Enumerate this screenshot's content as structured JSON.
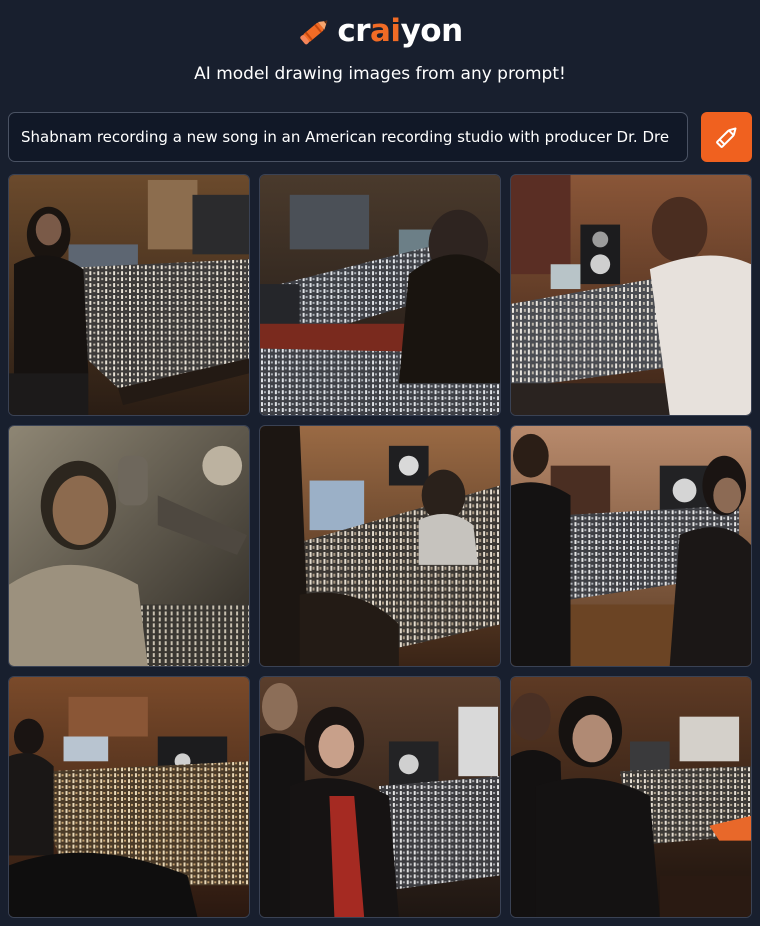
{
  "brand": {
    "name_prefix": "cr",
    "name_accent": "ai",
    "name_suffix": "yon",
    "logo_icon": "crayon-pencil-icon",
    "accent_color": "#f16b25"
  },
  "tagline": "AI model drawing images from any prompt!",
  "prompt": {
    "value": "Shabnam recording a new song in an American recording studio with producer Dr. Dre"
  },
  "draw_button": {
    "icon": "pencil-icon",
    "color": "#f0611f"
  },
  "results": {
    "count": 9,
    "images": [
      {
        "id": "result-image-1"
      },
      {
        "id": "result-image-2"
      },
      {
        "id": "result-image-3"
      },
      {
        "id": "result-image-4"
      },
      {
        "id": "result-image-5"
      },
      {
        "id": "result-image-6"
      },
      {
        "id": "result-image-7"
      },
      {
        "id": "result-image-8"
      },
      {
        "id": "result-image-9"
      }
    ]
  }
}
